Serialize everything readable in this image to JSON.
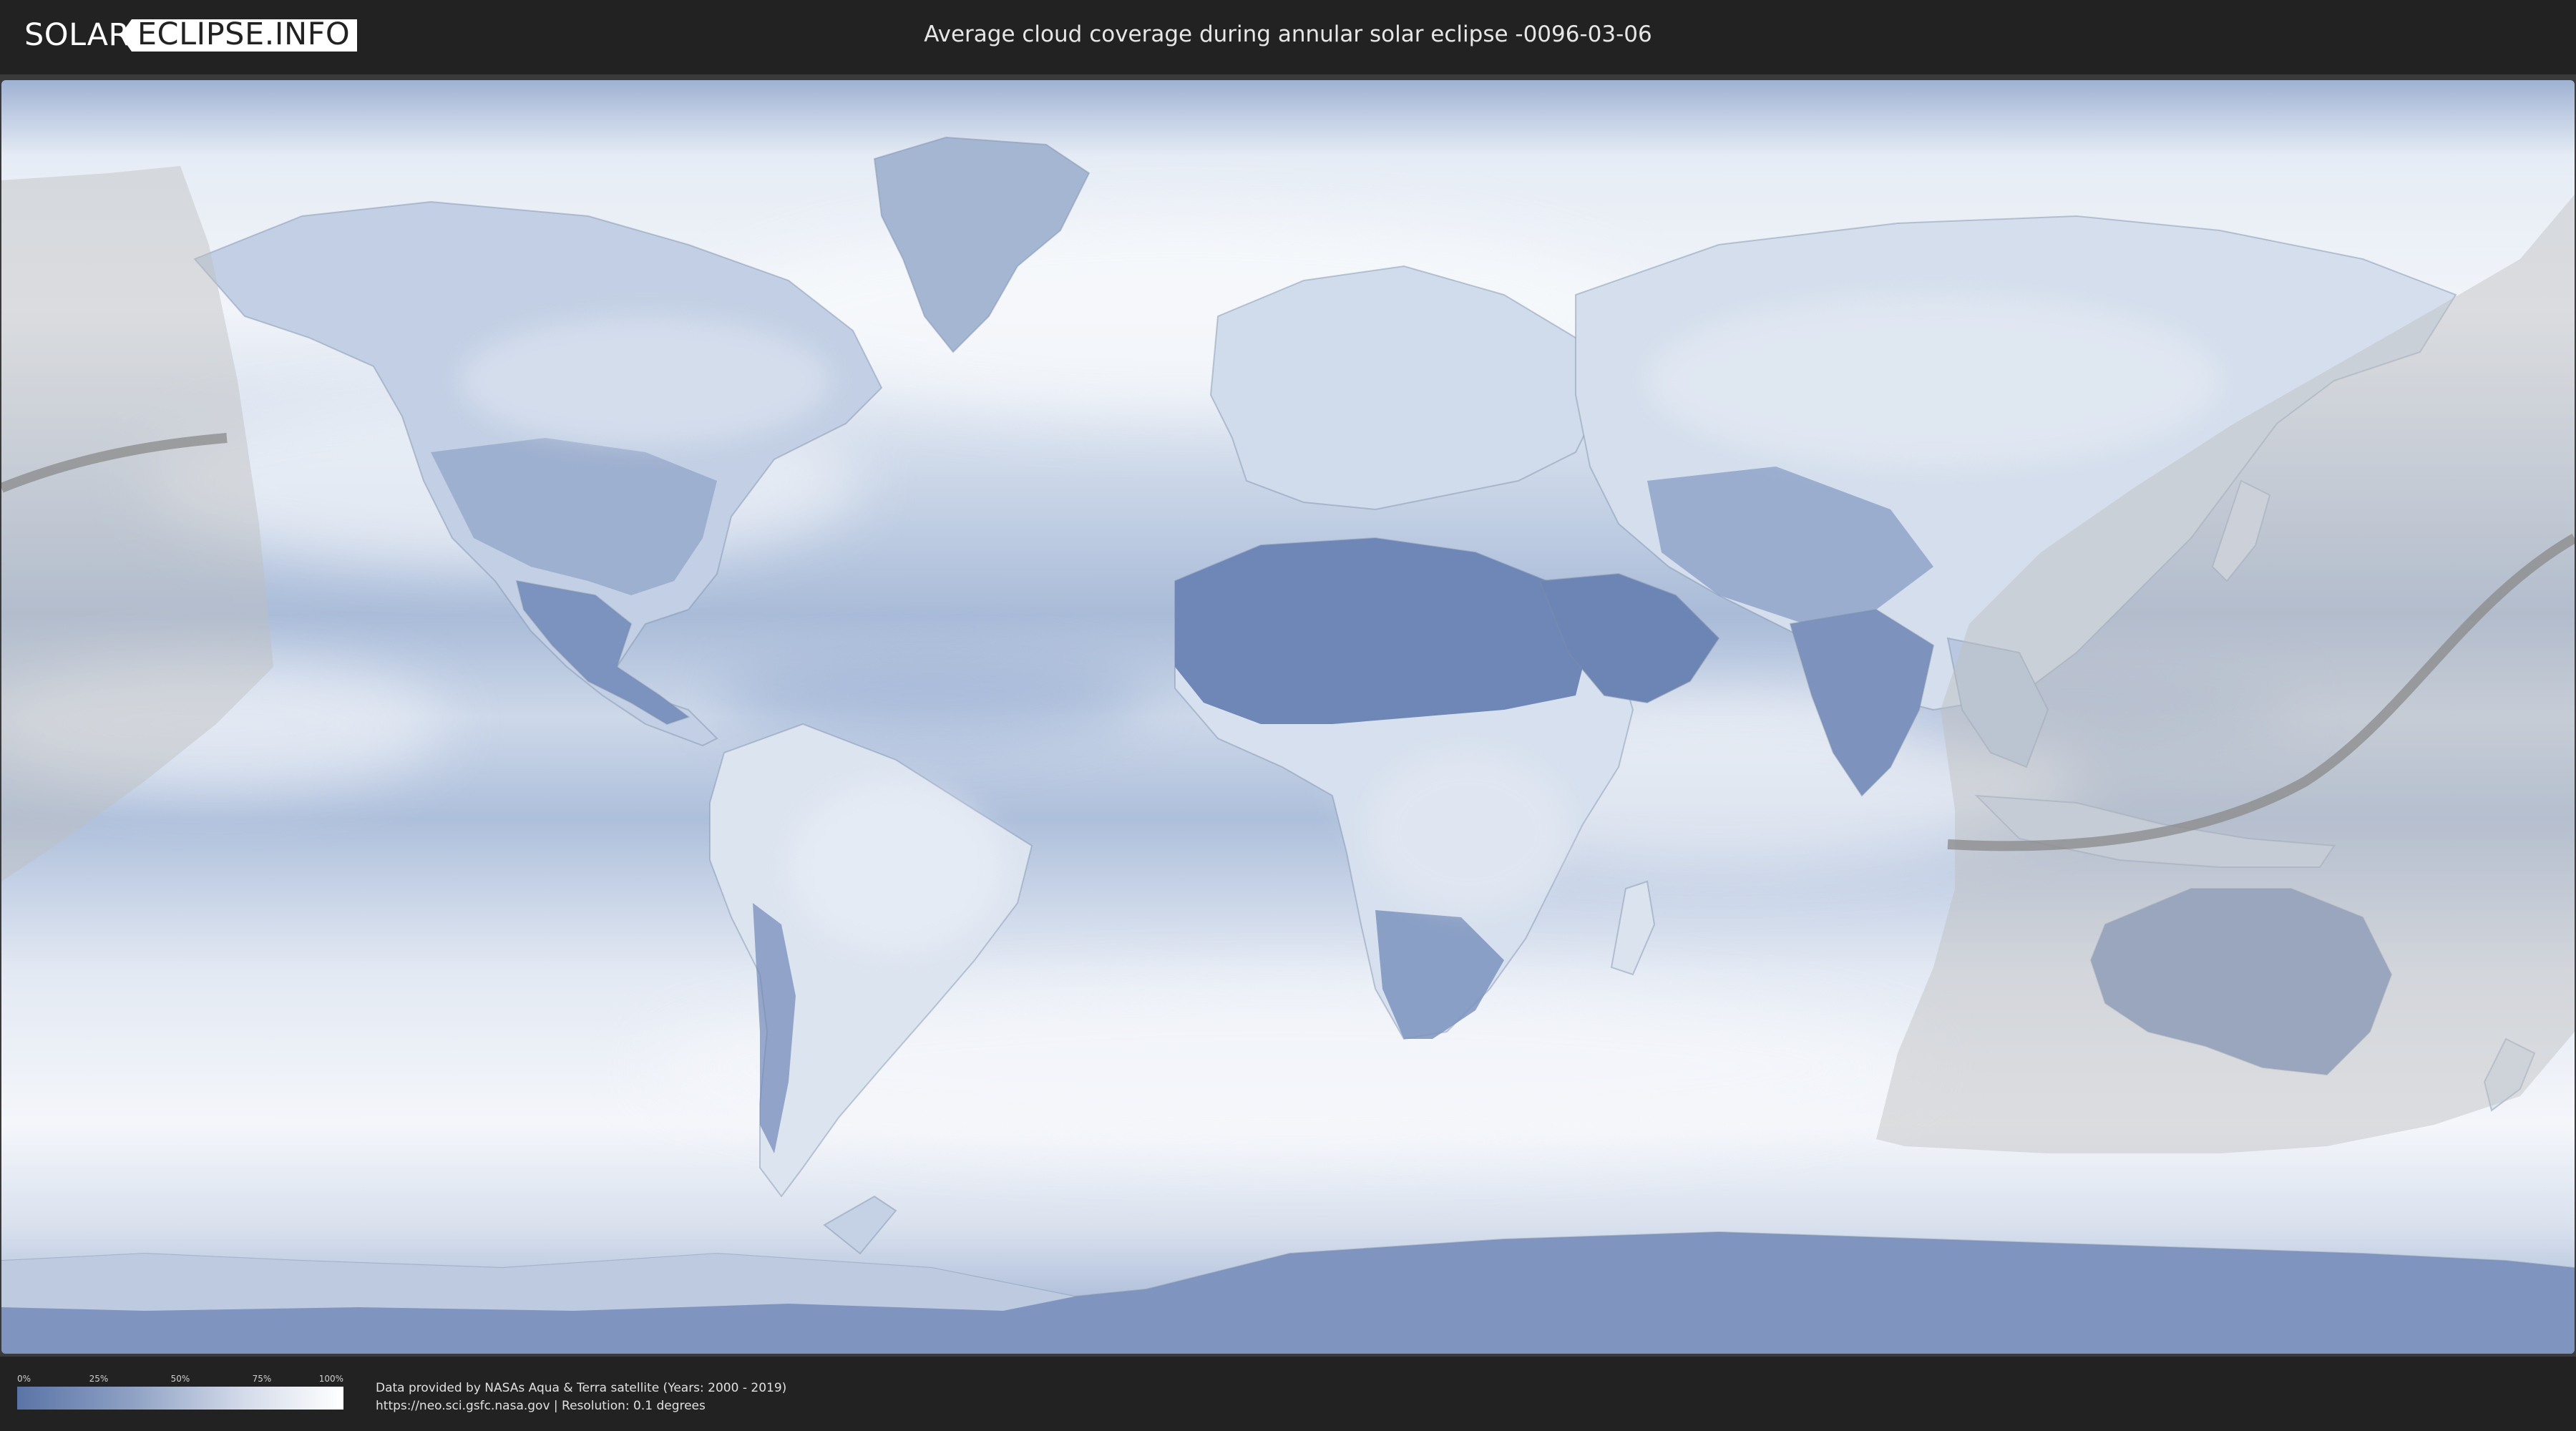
{
  "header": {
    "logo_left": "SOLAR",
    "logo_right": "ECLIPSE.INFO",
    "title": "Average cloud coverage during annular solar eclipse -0096-03-06"
  },
  "map": {
    "projection": "equirectangular",
    "colors": {
      "ocean_clear": "#6d86b5",
      "cloud_white": "#f3f6fb",
      "land_clear": "#5f78a8",
      "eclipse_zone": "#c9c9c9",
      "central_path": "#8a8a8a"
    }
  },
  "legend": {
    "ticks": [
      "0%",
      "25%",
      "50%",
      "75%",
      "100%"
    ],
    "tick_values": [
      0,
      25,
      50,
      75,
      100
    ],
    "gradient_start": "#5a74a6",
    "gradient_end": "#ffffff"
  },
  "credits": {
    "line1": "Data provided by NASAs Aqua & Terra satellite (Years: 2000 - 2019)",
    "line2": "https://neo.sci.gsfc.nasa.gov | Resolution: 0.1 degrees"
  }
}
